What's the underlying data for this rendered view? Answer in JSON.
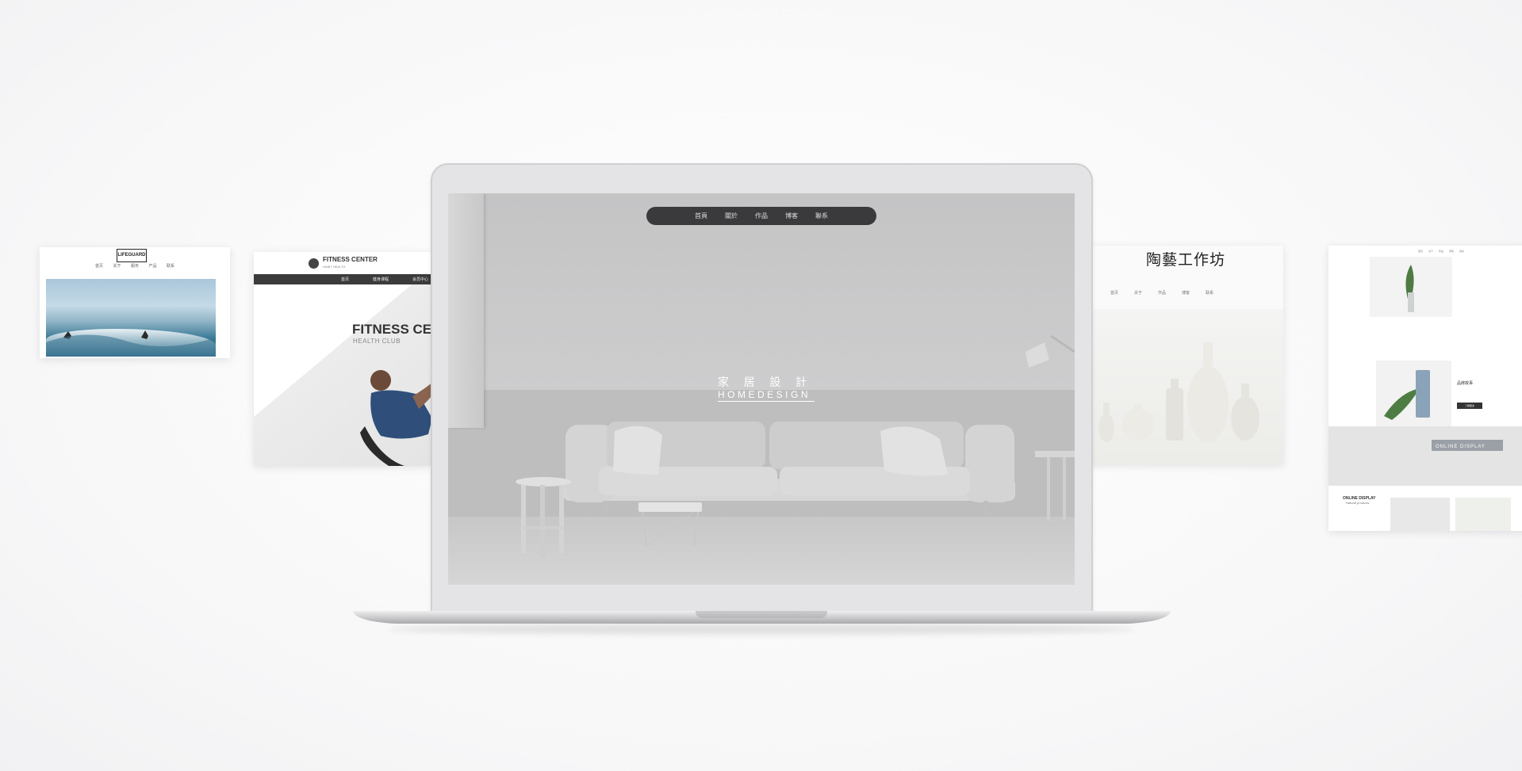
{
  "lifeguard_card": {
    "logo": "LIFEGUARD",
    "nav": [
      "首页",
      "关于",
      "服务",
      "产品",
      "联系"
    ]
  },
  "fitness_card": {
    "brand": "FITNESS CENTER",
    "brand_sub": "HABIT HEALTH",
    "nav": [
      "首页",
      "健身课程",
      "会员中心"
    ],
    "title": "FITNESS CENTER",
    "subtitle": "HEALTH CLUB"
  },
  "laptop": {
    "nav": [
      "首頁",
      "關於",
      "作品",
      "博客",
      "聯系"
    ],
    "hero_cn": [
      "家",
      "居",
      "設",
      "計"
    ],
    "hero_en": "HOMEDESIGN"
  },
  "pottery_card": {
    "brand": "陶藝工作坊",
    "nav": [
      "首页",
      "关于",
      "作品",
      "博客",
      "联系"
    ]
  },
  "plant_card": {
    "nav": [
      "首页",
      "关于",
      "作品",
      "博客",
      "联系"
    ],
    "product_title": "品牌故事",
    "button": "了解更多",
    "banner_text": "ONLINE DISPLAY",
    "section_title": "ONLINE DISPLAY",
    "section_sub": "Natural products"
  }
}
